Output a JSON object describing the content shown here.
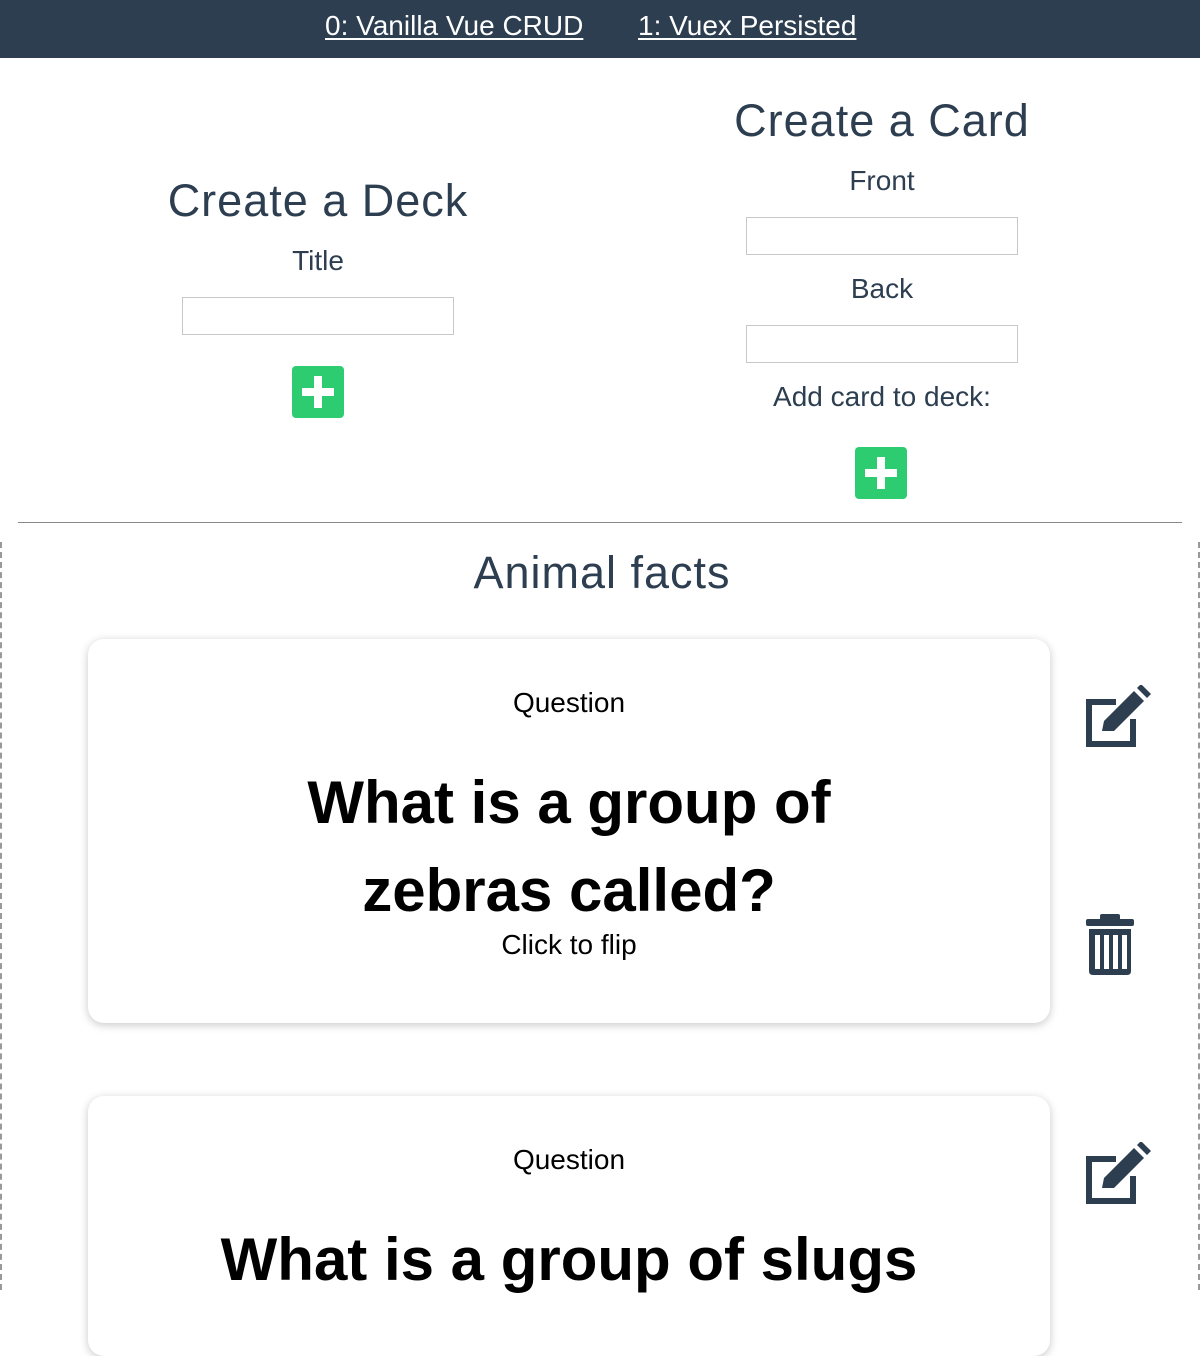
{
  "nav": {
    "links": [
      {
        "label": "0: Vanilla Vue CRUD"
      },
      {
        "label": "1: Vuex Persisted"
      }
    ]
  },
  "create_deck": {
    "heading": "Create a Deck",
    "title_label": "Title",
    "title_value": "",
    "add_icon": "plus-icon"
  },
  "create_card": {
    "heading": "Create a Card",
    "front_label": "Front",
    "front_value": "",
    "back_label": "Back",
    "back_value": "",
    "deck_label": "Add card to deck:",
    "add_icon": "plus-icon"
  },
  "deck": {
    "title": "Animal facts",
    "cards": [
      {
        "side_label": "Question",
        "question": "What is a group of zebras called?",
        "hint": "Click to flip",
        "edit_icon": "edit-icon",
        "delete_icon": "trash-icon"
      },
      {
        "side_label": "Question",
        "question": "What is a group of slugs",
        "edit_icon": "edit-icon"
      }
    ]
  },
  "colors": {
    "header_bg": "#2c3e50",
    "text": "#2c3e50",
    "accent_green": "#2ecc71"
  }
}
